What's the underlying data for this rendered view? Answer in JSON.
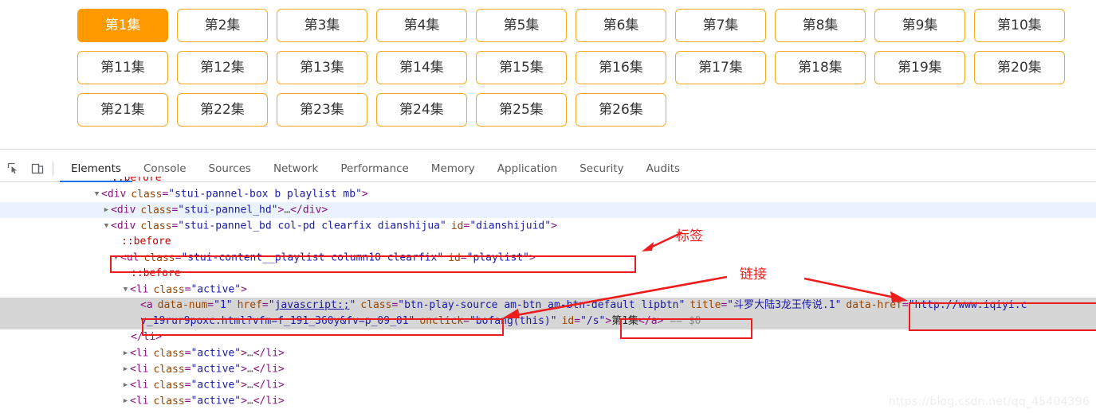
{
  "episode_panel": {
    "active_index": 0,
    "accent_color": "#ff9900",
    "border_color": "#f6a81c",
    "buttons": [
      {
        "label": "第1集"
      },
      {
        "label": "第2集"
      },
      {
        "label": "第3集"
      },
      {
        "label": "第4集"
      },
      {
        "label": "第5集"
      },
      {
        "label": "第6集"
      },
      {
        "label": "第7集"
      },
      {
        "label": "第8集"
      },
      {
        "label": "第9集"
      },
      {
        "label": "第10集"
      },
      {
        "label": "第11集"
      },
      {
        "label": "第12集"
      },
      {
        "label": "第13集"
      },
      {
        "label": "第14集"
      },
      {
        "label": "第15集"
      },
      {
        "label": "第16集"
      },
      {
        "label": "第17集"
      },
      {
        "label": "第18集"
      },
      {
        "label": "第19集"
      },
      {
        "label": "第20集"
      },
      {
        "label": "第21集"
      },
      {
        "label": "第22集"
      },
      {
        "label": "第23集"
      },
      {
        "label": "第24集"
      },
      {
        "label": "第25集"
      },
      {
        "label": "第26集"
      }
    ]
  },
  "devtools": {
    "toolbar_icons": [
      {
        "name": "inspect-element-icon"
      },
      {
        "name": "device-toolbar-icon"
      }
    ],
    "tabs": [
      {
        "label": "Elements",
        "active": true
      },
      {
        "label": "Console",
        "active": false
      },
      {
        "label": "Sources",
        "active": false
      },
      {
        "label": "Network",
        "active": false
      },
      {
        "label": "Performance",
        "active": false
      },
      {
        "label": "Memory",
        "active": false
      },
      {
        "label": "Application",
        "active": false
      },
      {
        "label": "Security",
        "active": false
      },
      {
        "label": "Audits",
        "active": false
      }
    ],
    "active_tab_underline_color": "#1a73e8",
    "dom_rows": {
      "r0_pseudo": "::before",
      "r1_div_box": {
        "tag": "div",
        "attr": "class",
        "value": "stui-pannel-box b playlist mb"
      },
      "r2_div_hd": {
        "tag": "div",
        "attr": "class",
        "value": "stui-pannel_hd",
        "collapsed_children": "…"
      },
      "r3_div_bd": {
        "tag": "div",
        "attr1": "class",
        "value1": "stui-pannel_bd col-pd clearfix dianshijua",
        "attr2": "id",
        "value2": "dianshijuid"
      },
      "r4_pseudo": "::before",
      "r5_ul": {
        "tag": "ul",
        "attr1": "class",
        "value1": "stui-content__playlist column10 clearfix",
        "attr2": "id",
        "value2": "playlist"
      },
      "r6_pseudo": "::before",
      "r7_li": {
        "tag": "li",
        "attr": "class",
        "value": "active"
      },
      "r8_anchor": {
        "tag": "a",
        "attr_data_num": "data-num",
        "val_data_num": "1",
        "attr_href": "href",
        "val_href": "javascript:;",
        "attr_class": "class",
        "val_class_part1": "btn-play-source am-btn am-btn-default lipbtn",
        "attr_title": "title",
        "val_title": "斗罗大陆3龙王传说.1",
        "attr_data_href": "data-href",
        "val_data_href_part1": "http://www.iqiyi.c",
        "val_data_href_part2": "v_19rur9poxc.html?vfm=f_191_360y&fv=p_09_01",
        "attr_onclick": "onclick",
        "val_onclick": "bofang(this)",
        "attr_id": "id",
        "val_id": "/s",
        "inner_text": "第1集",
        "selected_marker": "== $0"
      },
      "r10_li_close": "</li>",
      "r11_li": {
        "tag": "li",
        "attr": "class",
        "value": "active",
        "collapsed_children": "…"
      },
      "r12_li": {
        "tag": "li",
        "attr": "class",
        "value": "active",
        "collapsed_children": "…"
      },
      "r13_li": {
        "tag": "li",
        "attr": "class",
        "value": "active",
        "collapsed_children": "…"
      },
      "r14_li": {
        "tag": "li",
        "attr": "class",
        "value": "active",
        "collapsed_children": "…"
      }
    }
  },
  "annotations": {
    "color": "#ee1c1c",
    "label_tag": "标签",
    "label_link": "链接"
  },
  "watermark": {
    "text": "https://blog.csdn.net/qq_45404396"
  }
}
